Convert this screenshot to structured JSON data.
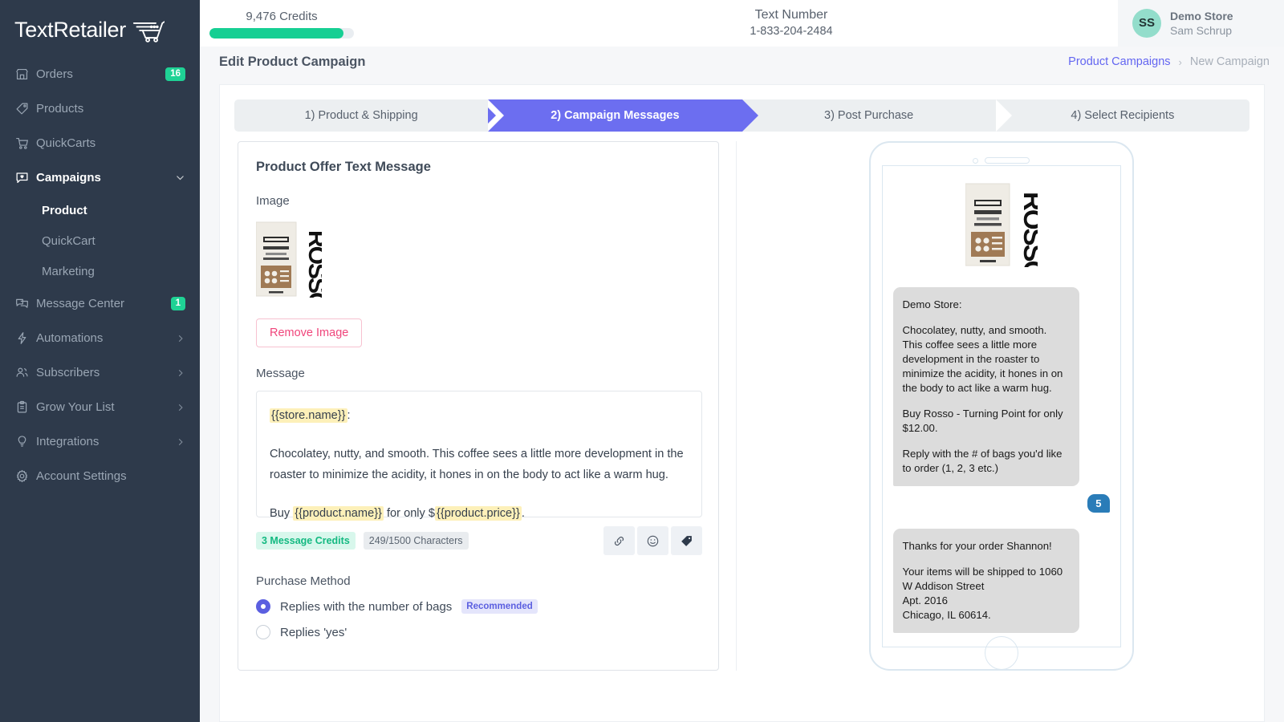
{
  "brand": {
    "name": "TextRetailer",
    "cart_icon": "shopping-cart-icon"
  },
  "sidebar": {
    "items": [
      {
        "label": "Orders",
        "icon": "store-icon",
        "badge": "16",
        "chevron": "",
        "active": false
      },
      {
        "label": "Products",
        "icon": "tag-icon",
        "badge": "",
        "chevron": "",
        "active": false
      },
      {
        "label": "QuickCarts",
        "icon": "cart-icon",
        "badge": "",
        "chevron": "",
        "active": false
      },
      {
        "label": "Campaigns",
        "icon": "message-heart-icon",
        "badge": "",
        "chevron": "chevron-down-icon",
        "active": true
      },
      {
        "label": "Message Center",
        "icon": "chat-bubbles-icon",
        "badge": "1",
        "chevron": "",
        "active": false
      },
      {
        "label": "Automations",
        "icon": "lightning-icon",
        "badge": "",
        "chevron": "chevron-right-icon",
        "active": false
      },
      {
        "label": "Subscribers",
        "icon": "people-icon",
        "badge": "",
        "chevron": "chevron-right-icon",
        "active": false
      },
      {
        "label": "Grow Your List",
        "icon": "clipboard-icon",
        "badge": "",
        "chevron": "chevron-right-icon",
        "active": false
      },
      {
        "label": "Integrations",
        "icon": "lightbulb-icon",
        "badge": "",
        "chevron": "chevron-right-icon",
        "active": false
      },
      {
        "label": "Account Settings",
        "icon": "gear-icon",
        "badge": "",
        "chevron": "",
        "active": false
      }
    ],
    "campaigns_sub": [
      {
        "label": "Product",
        "active": true
      },
      {
        "label": "QuickCart",
        "active": false
      },
      {
        "label": "Marketing",
        "active": false
      }
    ]
  },
  "topbar": {
    "credits_label": "9,476 Credits",
    "credits_percent": 93,
    "text_number_title": "Text Number",
    "text_number_value": "1-833-204-2484",
    "user_initials": "SS",
    "user_store": "Demo Store",
    "user_name": "Sam Schrup"
  },
  "subbar": {
    "page_title": "Edit Product Campaign",
    "breadcrumb_link": "Product Campaigns",
    "breadcrumb_sep": "›",
    "breadcrumb_current": "New Campaign"
  },
  "steps": [
    {
      "label": "1) Product & Shipping",
      "current": false
    },
    {
      "label": "2) Campaign Messages",
      "current": true
    },
    {
      "label": "3) Post Purchase",
      "current": false
    },
    {
      "label": "4) Select Recipients",
      "current": false
    }
  ],
  "form": {
    "card_title": "Product Offer Text Message",
    "image_label": "Image",
    "remove_image_button": "Remove Image",
    "message_label": "Message",
    "message": {
      "line1_var": "{{store.name}}",
      "line1_tail": ":",
      "body": "Chocolatey, nutty, and smooth. This coffee sees a little more development in the roaster to minimize the acidity, it hones in on the body to act like a warm hug.",
      "line3_pre": "Buy ",
      "line3_var1": "{{product.name}}",
      "line3_mid": " for only $",
      "line3_var2": "{{product.price}}",
      "line3_tail": "."
    },
    "credits_pill": "3 Message Credits",
    "chars_pill": "249/1500 Characters",
    "tools": [
      {
        "icon": "link-icon"
      },
      {
        "icon": "emoji-icon"
      },
      {
        "icon": "tag-icon"
      }
    ],
    "purchase_method_label": "Purchase Method",
    "purchase_options": [
      {
        "label": "Replies with the number of bags",
        "badge": "Recommended",
        "selected": true
      },
      {
        "label": "Replies 'yes'",
        "badge": "",
        "selected": false
      }
    ]
  },
  "preview": {
    "product_image_alt": "Rosso Turning Point coffee bag",
    "bubble1": {
      "sender": "Demo Store:",
      "para1": "Chocolatey, nutty, and smooth. This coffee sees a little more development in the roaster to minimize the acidity, it hones in on the body to act like a warm hug.",
      "para2": "Buy Rosso - Turning Point for only $12.00.",
      "para3": "Reply with the # of bags you'd like to order (1, 2, 3 etc.)"
    },
    "reply": "5",
    "bubble2": {
      "line1": "Thanks for your order Shannon!",
      "line2": "Your items will be shipped to 1060 W Addison Street",
      "line3": "Apt. 2016",
      "line4": "Chicago, IL 60614."
    }
  },
  "colors": {
    "sidebar_bg": "#2e3a4b",
    "accent_green": "#16cf93",
    "accent_purple": "#6c6ef0",
    "link_blue": "#6366f1",
    "danger_pink": "#f0457b",
    "bubble_in": "#dcdcdc",
    "bubble_out": "#2a7cb8"
  }
}
